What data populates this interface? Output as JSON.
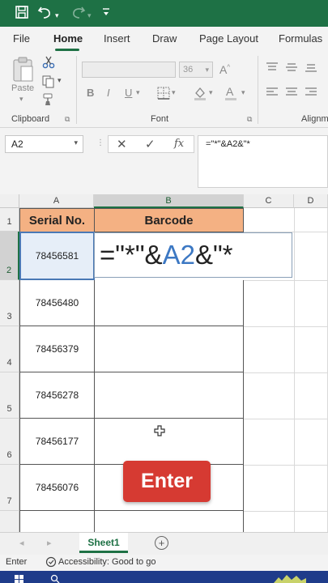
{
  "titlebar": {
    "save_icon": "save-icon",
    "undo_icon": "undo-icon",
    "redo_icon": "redo-icon",
    "customize_icon": "customize-quick-access-icon",
    "bg_color": "#1e7145"
  },
  "ribbon_tabs": [
    {
      "label": "File"
    },
    {
      "label": "Home",
      "active": true
    },
    {
      "label": "Insert"
    },
    {
      "label": "Draw"
    },
    {
      "label": "Page Layout"
    },
    {
      "label": "Formulas"
    }
  ],
  "ribbon": {
    "clipboard": {
      "paste_label": "Paste",
      "group_label": "Clipboard"
    },
    "font": {
      "font_name": "",
      "font_size": "36",
      "bold": "B",
      "italic": "I",
      "underline": "U",
      "font_color_letter": "A",
      "group_label": "Font"
    },
    "alignment": {
      "group_label": "Alignm"
    }
  },
  "formula_bar": {
    "name_box": "A2",
    "cancel_icon": "✕",
    "enter_icon": "✓",
    "fx_label": "fx",
    "formula": "=\"*\"&A2&\"*"
  },
  "grid": {
    "columns": [
      "A",
      "B",
      "C",
      "D"
    ],
    "rows": [
      "1",
      "2",
      "3",
      "4",
      "5",
      "6",
      "7"
    ],
    "headers": {
      "a1": "Serial No.",
      "b1": "Barcode"
    },
    "serials": [
      "78456581",
      "78456480",
      "78456379",
      "78456278",
      "78456177",
      "78456076"
    ],
    "edit_formula": {
      "prefix": "=\"*\"&",
      "ref": "A2",
      "suffix": "&\"*"
    },
    "header_fill": "#f4b183",
    "ref_color": "#3c78c3"
  },
  "overlay": {
    "enter_label": "Enter",
    "enter_color": "#d63a32"
  },
  "sheet_tabs": {
    "active": "Sheet1",
    "add_icon": "⊕"
  },
  "status": {
    "mode": "Enter",
    "accessibility": "Accessibility: Good to go"
  }
}
